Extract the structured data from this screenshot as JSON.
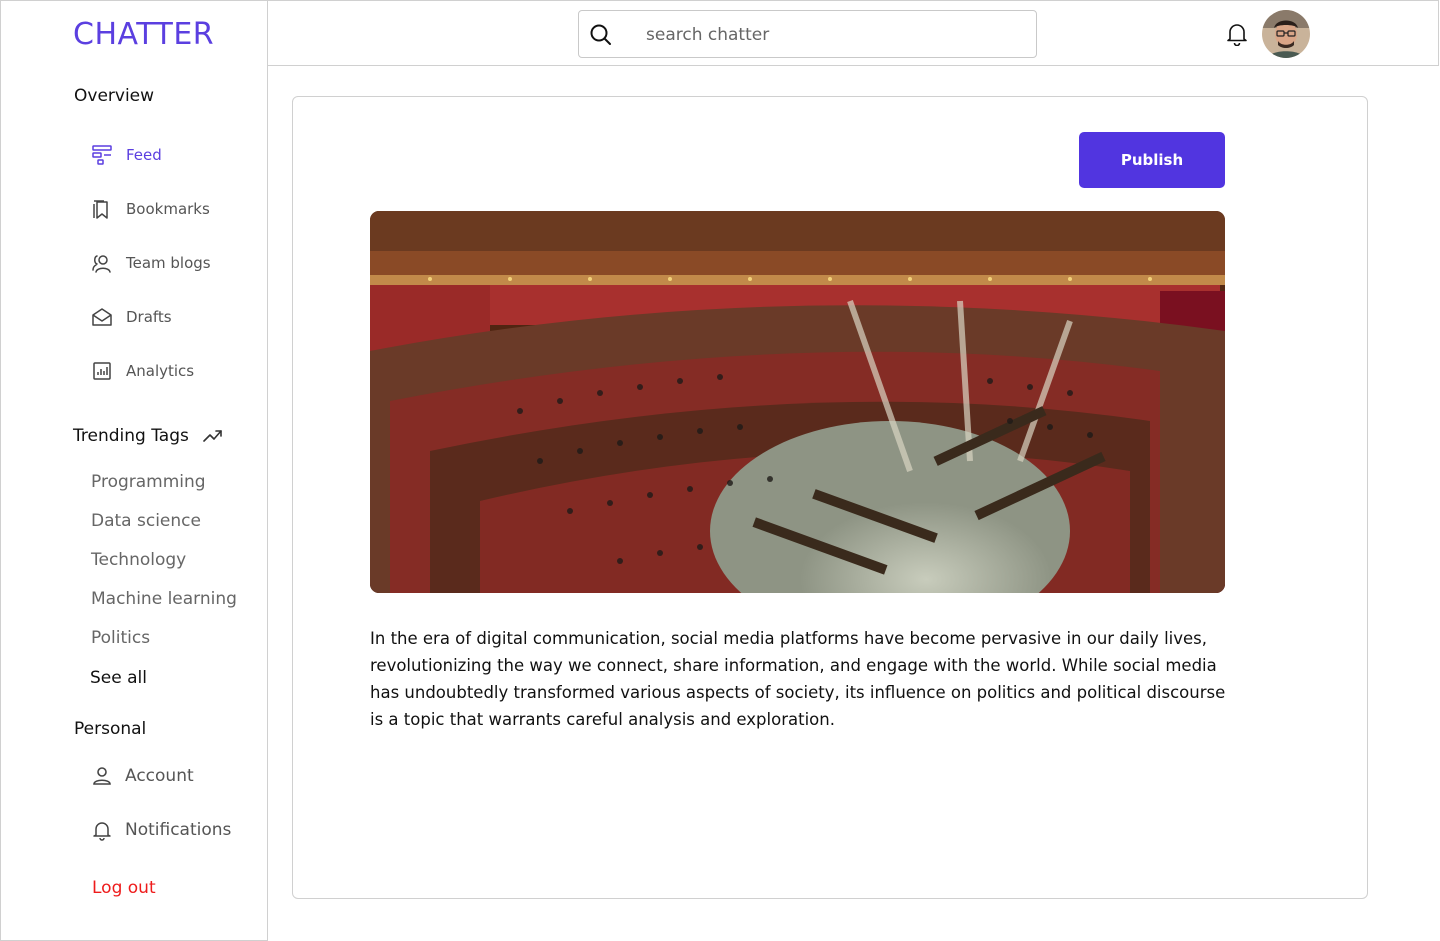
{
  "brand": {
    "name": "CHATTER",
    "accent": "#5b3fe0"
  },
  "sidebar": {
    "overview_title": "Overview",
    "nav": [
      {
        "label": "Feed",
        "icon": "feed-icon",
        "active": true
      },
      {
        "label": "Bookmarks",
        "icon": "bookmark-icon",
        "active": false
      },
      {
        "label": "Team blogs",
        "icon": "team-icon",
        "active": false
      },
      {
        "label": "Drafts",
        "icon": "drafts-icon",
        "active": false
      },
      {
        "label": "Analytics",
        "icon": "analytics-icon",
        "active": false
      }
    ],
    "trending_title": "Trending Tags",
    "trending_icon": "trending-up-icon",
    "tags": [
      "Programming",
      "Data science",
      "Technology",
      "Machine learning",
      "Politics"
    ],
    "see_all": "See all",
    "personal_title": "Personal",
    "personal": [
      {
        "label": "Account",
        "icon": "user-icon"
      },
      {
        "label": "Notifications",
        "icon": "bell-icon"
      }
    ],
    "logout": "Log out",
    "logout_color": "#ee1b1b"
  },
  "topbar": {
    "search_placeholder": "search chatter",
    "search_icon": "search-icon",
    "bell_icon": "bell-icon",
    "avatar": "user-avatar"
  },
  "post": {
    "publish_label": "Publish",
    "image_alt": "parliament-chamber-image",
    "body": "In the era of digital communication, social media platforms have become pervasive in our daily lives, revolutionizing the way we connect, share information, and engage with the world. While social media has undoubtedly transformed various aspects of society, its influence on politics and political discourse is a topic that warrants careful analysis and exploration."
  }
}
